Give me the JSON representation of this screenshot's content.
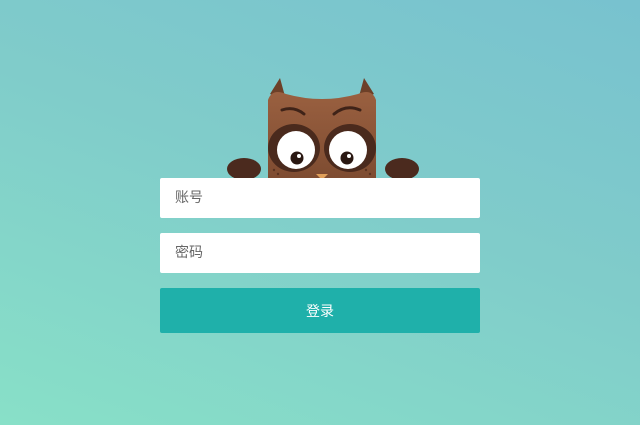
{
  "mascot": {
    "icon": "owl-icon"
  },
  "form": {
    "account_placeholder": "账号",
    "password_placeholder": "密码",
    "account_value": "",
    "password_value": "",
    "login_label": "登录"
  },
  "colors": {
    "background_top": "#78c2cf",
    "background_bottom": "#88e0c8",
    "button": "#1fb0aa",
    "owl_body": "#8b5638",
    "owl_paw": "#4b2a1e"
  }
}
